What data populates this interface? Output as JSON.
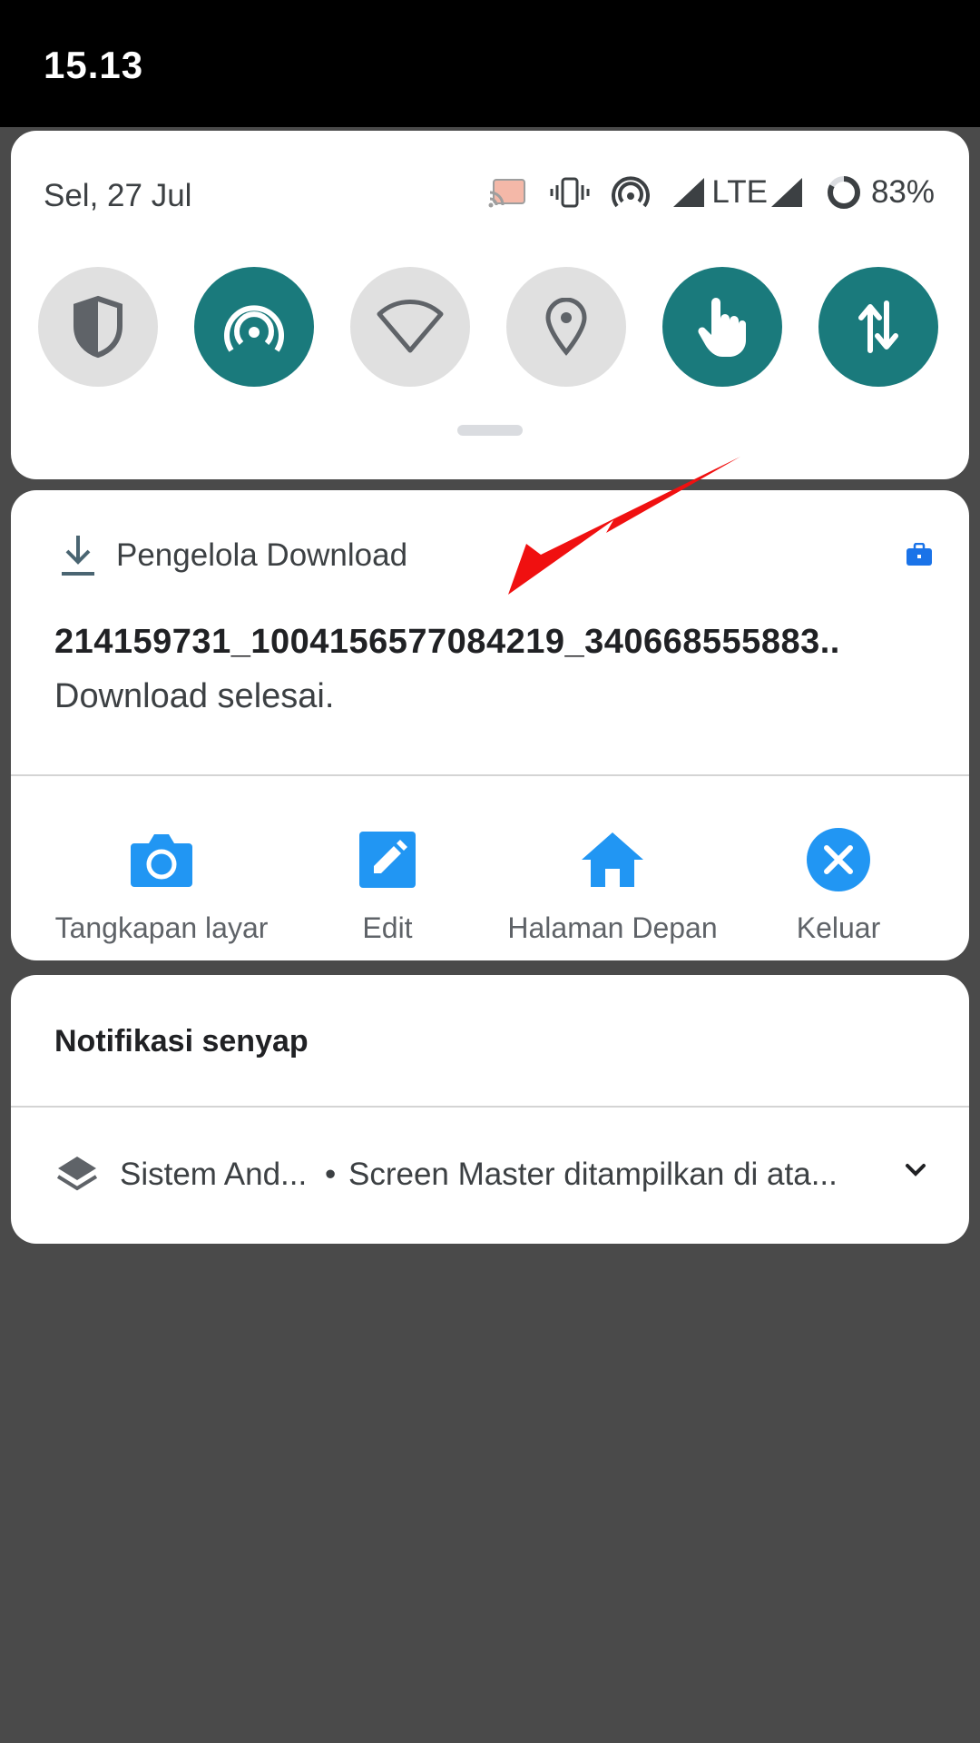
{
  "status_bar": {
    "time": "15.13"
  },
  "quick_settings": {
    "date": "Sel, 27 Jul",
    "network_type": "LTE",
    "battery_percent": "83%",
    "battery_level": 0.83,
    "tiles": [
      {
        "name": "vpn",
        "icon": "shield-icon",
        "on": false
      },
      {
        "name": "hotspot",
        "icon": "hotspot-icon",
        "on": true
      },
      {
        "name": "wifi",
        "icon": "wifi-icon",
        "on": false
      },
      {
        "name": "location",
        "icon": "location-icon",
        "on": false
      },
      {
        "name": "touch",
        "icon": "touch-icon",
        "on": true
      },
      {
        "name": "mobile-data",
        "icon": "data-arrows-icon",
        "on": true
      }
    ]
  },
  "download_notification": {
    "app_name": "Pengelola Download",
    "title": "214159731_1004156577084219_340668555883..",
    "text": "Download selesai.",
    "actions": [
      {
        "label": "Tangkapan layar",
        "icon": "camera-icon"
      },
      {
        "label": "Edit",
        "icon": "edit-icon"
      },
      {
        "label": "Halaman Depan",
        "icon": "home-icon"
      },
      {
        "label": "Keluar",
        "icon": "close-icon"
      }
    ]
  },
  "silent_section": {
    "header": "Notifikasi senyap",
    "items": [
      {
        "app": "Sistem And...",
        "separator": "•",
        "message": "Screen Master ditampilkan di ata..."
      }
    ]
  },
  "colors": {
    "tile_on": "#1a7a7c",
    "tile_off": "#e0e0e0",
    "action_blue": "#2196f3",
    "annotation_red": "#f01010"
  }
}
